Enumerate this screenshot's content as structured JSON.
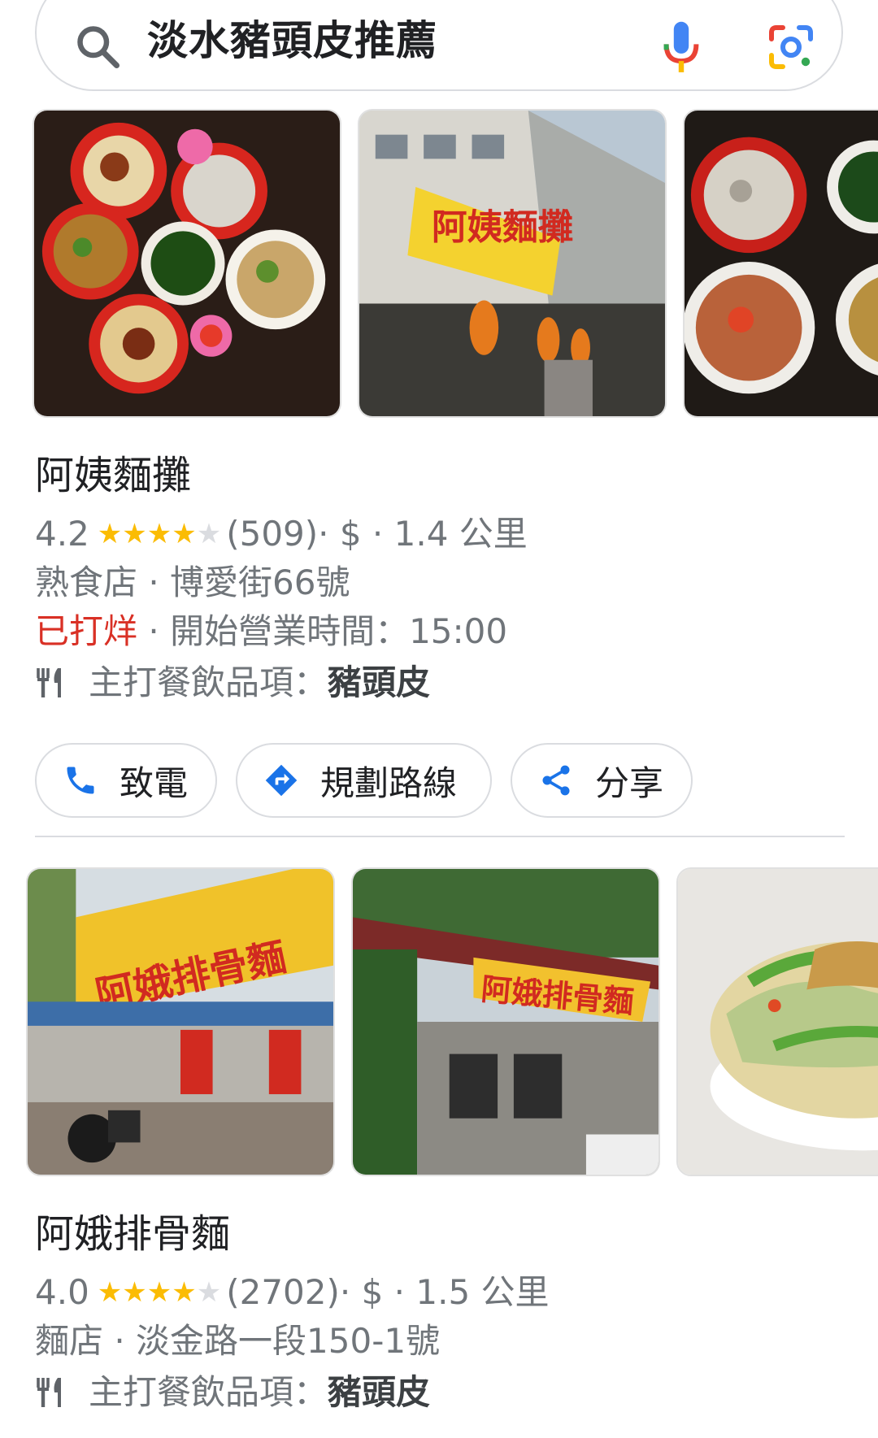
{
  "search": {
    "query": "淡水豬頭皮推薦"
  },
  "colors": {
    "star": "#fbbc04",
    "closed": "#d93025",
    "link_blue": "#1a73e8",
    "secondary_text": "#70757a"
  },
  "listings": [
    {
      "name": "阿姨麵攤",
      "rating": "4.2",
      "stars": 4.2,
      "reviews": "(509)",
      "details": " · $ · 1.4 公里",
      "category_address": "熟食店 · 博愛街66號",
      "status_closed": "已打烊",
      "hours": " · 開始營業時間：15:00",
      "dish_label": "主打餐飲品項：",
      "dish": "豬頭皮",
      "photos": [
        "food-spread-photo",
        "storefront-photo",
        "rice-soup-photo"
      ]
    },
    {
      "name": "阿娥排骨麵",
      "rating": "4.0",
      "stars": 4.0,
      "reviews": "(2702)",
      "details": " · $ · 1.5 公里",
      "category_address": "麵店 · 淡金路一段150-1號",
      "dish_label": "主打餐飲品項：",
      "dish": "豬頭皮",
      "photos": [
        "storefront-sign-photo",
        "storefront-street-photo",
        "salad-bowl-photo"
      ]
    }
  ],
  "actions": {
    "call": "致電",
    "directions": "規劃路線",
    "share": "分享"
  },
  "icons": [
    "search-icon",
    "mic-icon",
    "lens-icon",
    "utensils-icon",
    "phone-icon",
    "directions-icon",
    "share-icon",
    "star-icon"
  ]
}
